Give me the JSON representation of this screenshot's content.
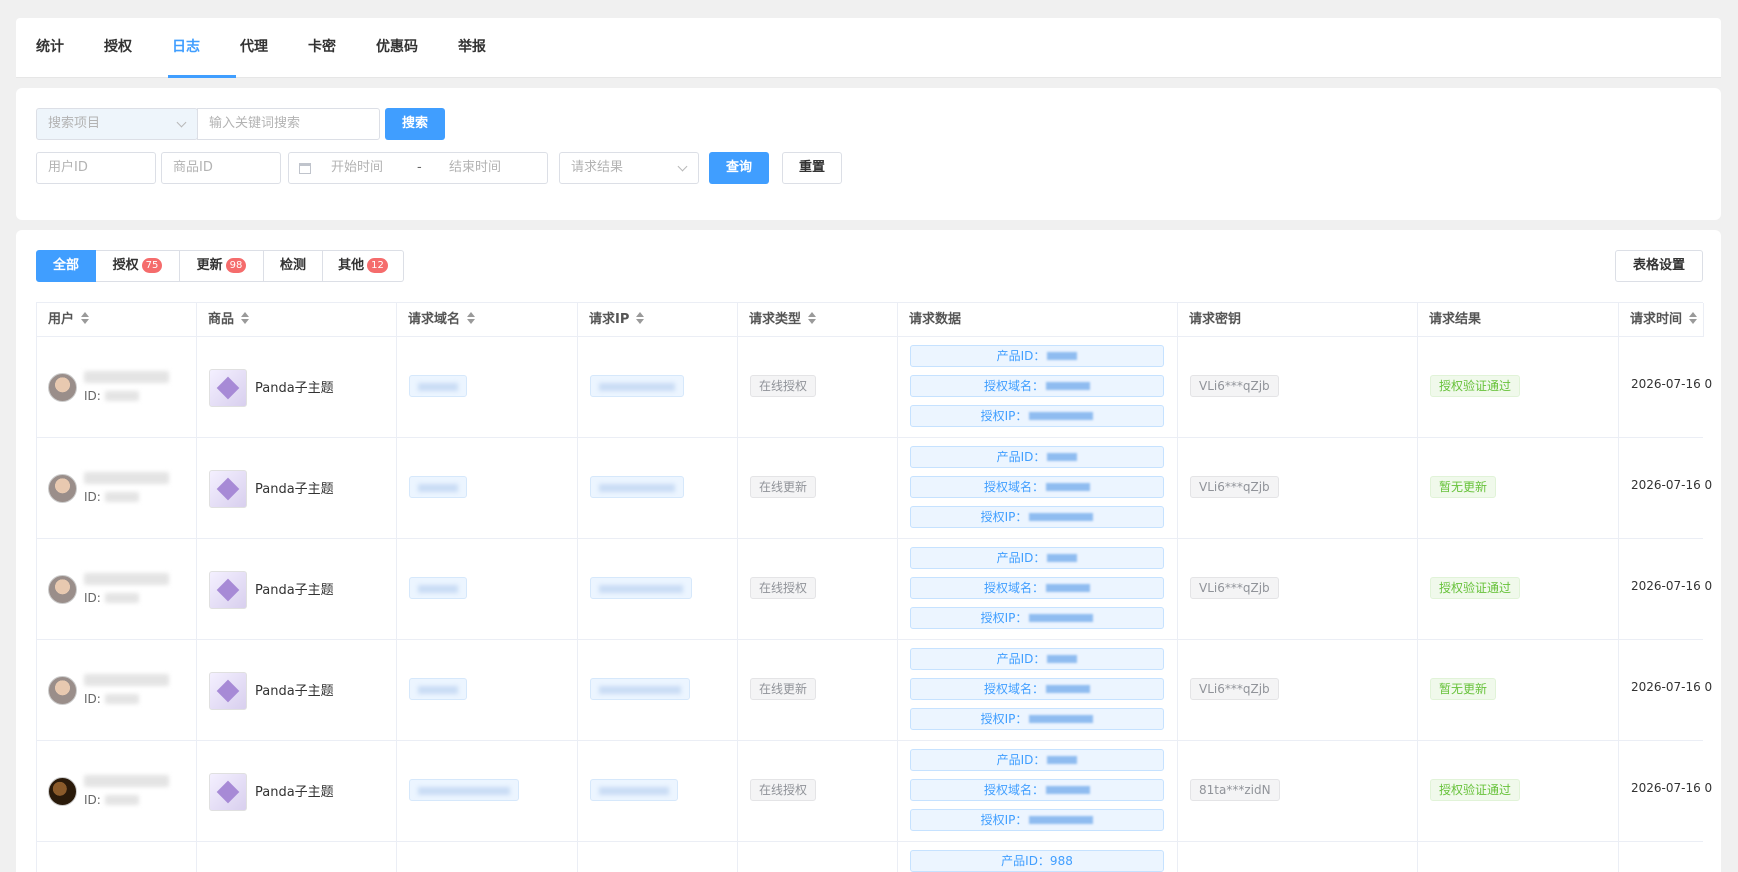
{
  "top_tabs": [
    "统计",
    "授权",
    "日志",
    "代理",
    "卡密",
    "优惠码",
    "举报"
  ],
  "active_tab": "日志",
  "filters": {
    "search_item_placeholder": "搜索项目",
    "keyword_placeholder": "输入关键词搜索",
    "search_button": "搜索",
    "user_id_placeholder": "用户ID",
    "product_id_placeholder": "商品ID",
    "start_time_placeholder": "开始时间",
    "date_separator": "-",
    "end_time_placeholder": "结束时间",
    "result_placeholder": "请求结果",
    "query_button": "查询",
    "reset_button": "重置"
  },
  "segments": [
    {
      "label": "全部",
      "badge": ""
    },
    {
      "label": "授权",
      "badge": "75"
    },
    {
      "label": "更新",
      "badge": "98"
    },
    {
      "label": "检测",
      "badge": ""
    },
    {
      "label": "其他",
      "badge": "12"
    }
  ],
  "table_settings_button": "表格设置",
  "columns": [
    "用户",
    "商品",
    "请求域名",
    "请求IP",
    "请求类型",
    "请求数据",
    "请求密钥",
    "请求结果",
    "请求时间"
  ],
  "data_labels": {
    "product_id": "产品ID：",
    "auth_domain": "授权域名：",
    "auth_ip": "授权IP："
  },
  "id_label": "ID:",
  "rows": [
    {
      "product": "Panda子主题",
      "type": "在线授权",
      "key": "VLi6***qZjb",
      "result": "授权验证通过",
      "time": "2026-07-16 0"
    },
    {
      "product": "Panda子主题",
      "type": "在线更新",
      "key": "VLi6***qZjb",
      "result": "暂无更新",
      "time": "2026-07-16 0"
    },
    {
      "product": "Panda子主题",
      "type": "在线授权",
      "key": "VLi6***qZjb",
      "result": "授权验证通过",
      "time": "2026-07-16 0"
    },
    {
      "product": "Panda子主题",
      "type": "在线更新",
      "key": "VLi6***qZjb",
      "result": "暂无更新",
      "time": "2026-07-16 0"
    },
    {
      "product": "Panda子主题",
      "type": "在线授权",
      "key": "81ta***zidN",
      "result": "授权验证通过",
      "time": "2026-07-16 0"
    }
  ],
  "partial_row_product_id": "产品ID：988"
}
